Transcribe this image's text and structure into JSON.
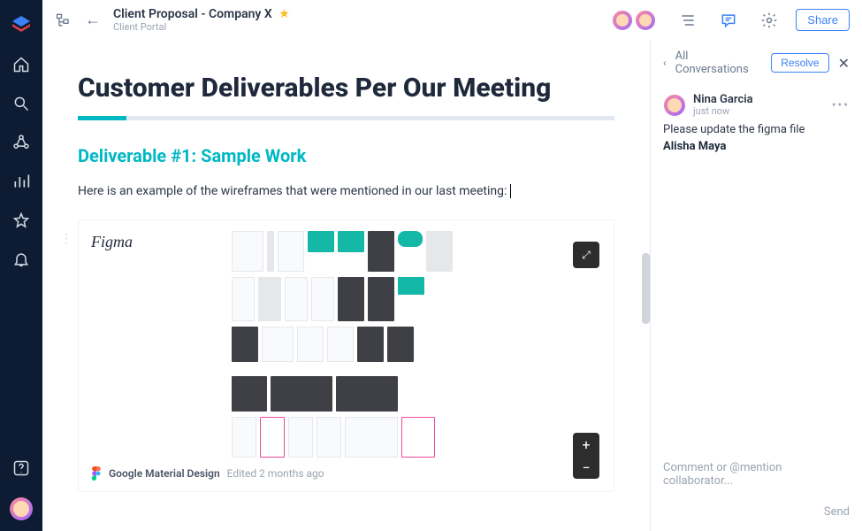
{
  "colors": {
    "accent": "#00b8c4",
    "primary": "#3b82f6",
    "nav_bg": "#0d1c33"
  },
  "nav": {
    "items": [
      "home",
      "search",
      "share-graph",
      "charts",
      "star",
      "bell"
    ],
    "bottom": [
      "help",
      "profile"
    ]
  },
  "top": {
    "title": "Client Proposal - Company X",
    "subtitle": "Client Portal",
    "starred": true,
    "presence_count": 2,
    "share_label": "Share"
  },
  "doc": {
    "h1": "Customer Deliverables Per Our Meeting",
    "h2": "Deliverable #1: Sample Work",
    "p1": "Here is an example of the wireframes that were mentioned in our last meeting:"
  },
  "embed": {
    "provider": "Figma",
    "file_name": "Google Material Design",
    "edited": "Edited 2 months ago",
    "icons": {
      "expand": "⤢",
      "plus": "+",
      "minus": "−"
    }
  },
  "comments": {
    "back_label": "All Conversations",
    "resolve_label": "Resolve",
    "items": [
      {
        "author": "Nina Garcia",
        "time": "just now",
        "body": "Please update the figma file",
        "mention": "Alisha Maya"
      }
    ],
    "compose_placeholder": "Comment or @mention collaborator...",
    "send_label": "Send"
  }
}
